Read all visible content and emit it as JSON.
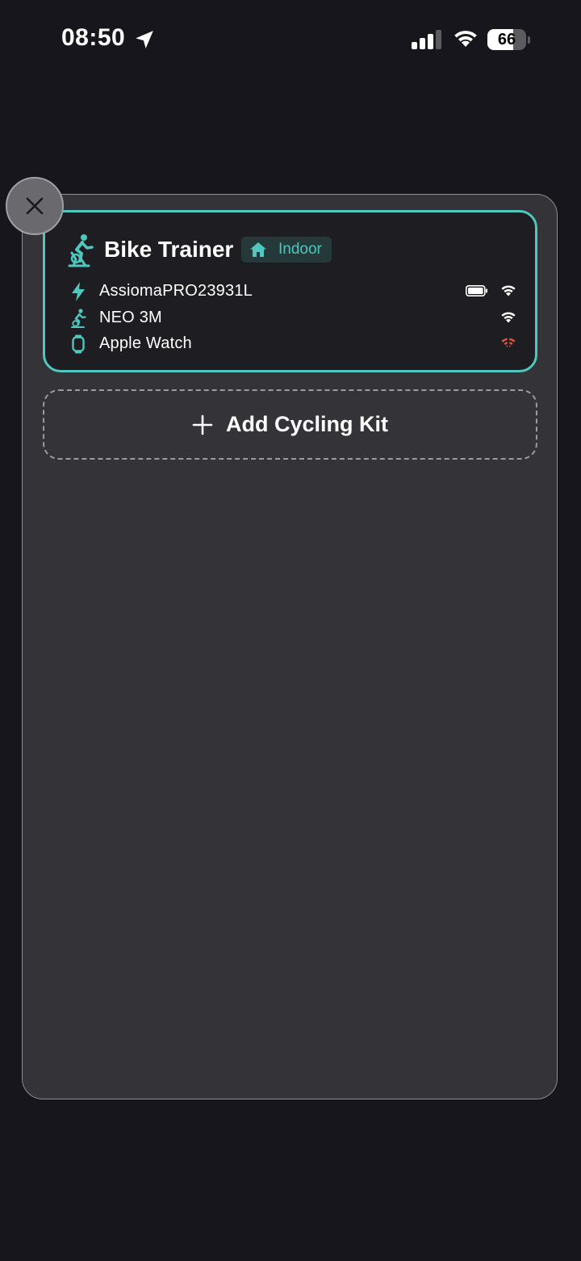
{
  "status_bar": {
    "time": "08:50",
    "battery_level": "66",
    "battery_fill_percent": 66,
    "icons": [
      "location-arrow-icon",
      "cellular-signal-icon",
      "wifi-icon",
      "battery-icon"
    ]
  },
  "panel": {
    "close_icon": "close-icon"
  },
  "kit": {
    "title": "Bike Trainer",
    "icon": "cyclist-icon",
    "badge": {
      "icon": "home-icon",
      "label": "Indoor"
    },
    "devices": [
      {
        "name": "AssiomaPRO23931L",
        "icon": "bolt-icon",
        "battery": true,
        "signal": "connected"
      },
      {
        "name": "NEO 3M",
        "icon": "trainer-icon",
        "battery": false,
        "signal": "connected"
      },
      {
        "name": "Apple Watch",
        "icon": "watch-icon",
        "battery": false,
        "signal": "disconnected"
      }
    ]
  },
  "add_kit": {
    "label": "Add Cycling Kit",
    "icon": "plus-icon"
  },
  "colors": {
    "accent": "#4fc7be",
    "background": "#16161c",
    "panel": "#333338",
    "card": "#1d1d22",
    "signal_connected": "#ffffff",
    "signal_disconnected": "#d9533f"
  }
}
